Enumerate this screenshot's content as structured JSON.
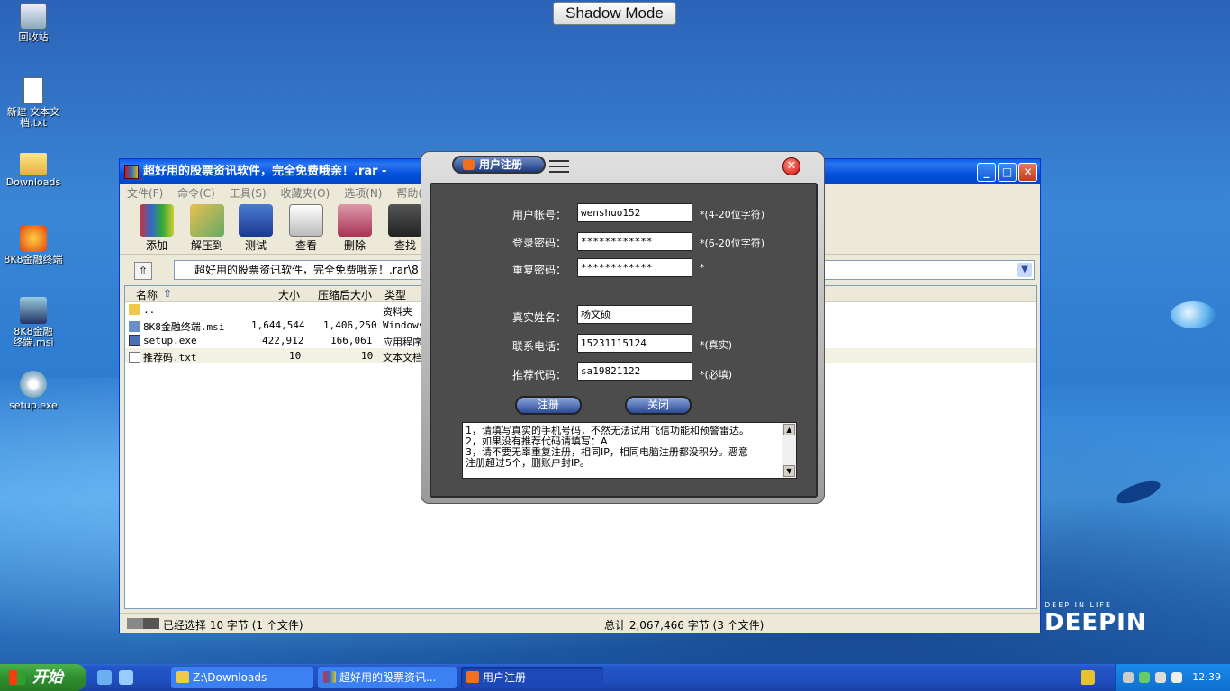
{
  "shadow_mode_label": "Shadow Mode",
  "desktop": {
    "icons": [
      {
        "label": "回收站",
        "icon": "recycle-bin-icon"
      },
      {
        "label": "新建 文本文档.txt",
        "icon": "text-file-icon"
      },
      {
        "label": "Downloads",
        "icon": "folder-shortcut-icon"
      },
      {
        "label": "8K8金融终端",
        "icon": "app-shortcut-icon"
      },
      {
        "label": "8K8金融终端.msi",
        "icon": "installer-icon"
      },
      {
        "label": "setup.exe",
        "icon": "setup-cd-icon"
      }
    ],
    "brand_small": "DEEP IN LIFE",
    "brand_big": "DEEPIN"
  },
  "rar_window": {
    "title": "超好用的股票资讯软件，完全免费哦亲！.rar - ",
    "menu": [
      "文件(F)",
      "命令(C)",
      "工具(S)",
      "收藏夹(O)",
      "选项(N)",
      "帮助(H)"
    ],
    "toolbar": [
      "添加",
      "解压到",
      "测试",
      "查看",
      "删除",
      "查找"
    ],
    "address": "超好用的股票资讯软件，完全免费哦亲！.rar\\8",
    "columns": [
      "名称",
      "大小",
      "压缩后大小",
      "类型"
    ],
    "files": [
      {
        "name": "..",
        "size": "",
        "packed": "",
        "type": "资料夹"
      },
      {
        "name": "8K8金融终端.msi",
        "size": "1,644,544",
        "packed": "1,406,250",
        "type": "Windows"
      },
      {
        "name": "setup.exe",
        "size": "422,912",
        "packed": "166,061",
        "type": "应用程序"
      },
      {
        "name": "推荐码.txt",
        "size": "10",
        "packed": "10",
        "type": "文本文档"
      }
    ],
    "status_left": "已经选择 10 字节 (1 个文件)",
    "status_right": "总计 2,067,466 字节 (3 个文件)"
  },
  "register_dialog": {
    "title": "用户注册",
    "fields": [
      {
        "label": "用户帐号：",
        "value": "wenshuo152",
        "hint": "*(4-20位字符)"
      },
      {
        "label": "登录密码：",
        "value": "************",
        "hint": "*(6-20位字符)"
      },
      {
        "label": "重复密码：",
        "value": "************",
        "hint": "*"
      },
      {
        "label": "真实姓名：",
        "value": "杨文硕",
        "hint": ""
      },
      {
        "label": "联系电话：",
        "value": "15231115124",
        "hint": "*(真实)"
      },
      {
        "label": "推荐代码：",
        "value": "sa19821122",
        "hint": "*(必填)"
      }
    ],
    "register_label": "注册",
    "close_label": "关闭",
    "notes": [
      "1，请填写真实的手机号码，不然无法试用飞信功能和预警雷达。",
      "2，如果没有推荐代码请填写：A",
      "3，请不要无辜重复注册，相同IP，相同电脑注册都没积分。恶意",
      "注册超过5个，删账户封IP。"
    ]
  },
  "taskbar": {
    "start_label": "开始",
    "tasks": [
      {
        "label": "Z:\\Downloads",
        "icon": "folder-icon"
      },
      {
        "label": "超好用的股票资讯...",
        "icon": "winrar-icon"
      },
      {
        "label": "用户注册",
        "icon": "app-icon"
      }
    ],
    "clock": "12:39"
  }
}
